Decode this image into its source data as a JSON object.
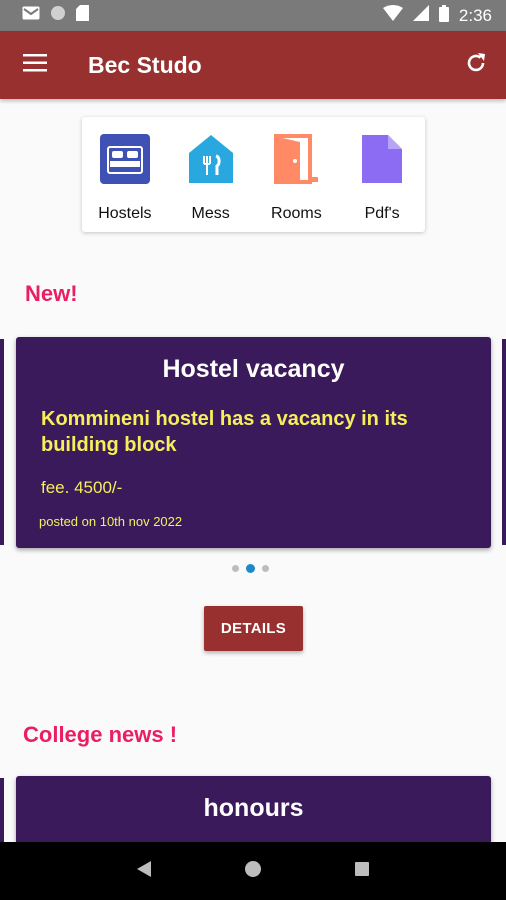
{
  "status_bar": {
    "time": "2:36"
  },
  "app_bar": {
    "title": "Bec Studo"
  },
  "categories": [
    {
      "label": "Hostels",
      "icon": "bed-icon",
      "color": "#3f51b5"
    },
    {
      "label": "Mess",
      "icon": "restaurant-icon",
      "color": "#29a8e0"
    },
    {
      "label": "Rooms",
      "icon": "door-icon",
      "color": "#ff8a65"
    },
    {
      "label": "Pdf's",
      "icon": "document-icon",
      "color": "#8c6cf2"
    }
  ],
  "new_section": {
    "title": "New!",
    "card": {
      "title": "Hostel vacancy",
      "message": "Kommineni hostel has a vacancy in its building block",
      "fee": "fee. 4500/-",
      "posted": "posted on 10th nov 2022"
    },
    "details_label": "DETAILS"
  },
  "college_section": {
    "title": "College news !",
    "card": {
      "title": "honours"
    }
  },
  "colors": {
    "primary": "#97302f",
    "accent": "#e91e63",
    "card_bg": "#3a1a5a",
    "card_text": "#f6ee5a"
  }
}
